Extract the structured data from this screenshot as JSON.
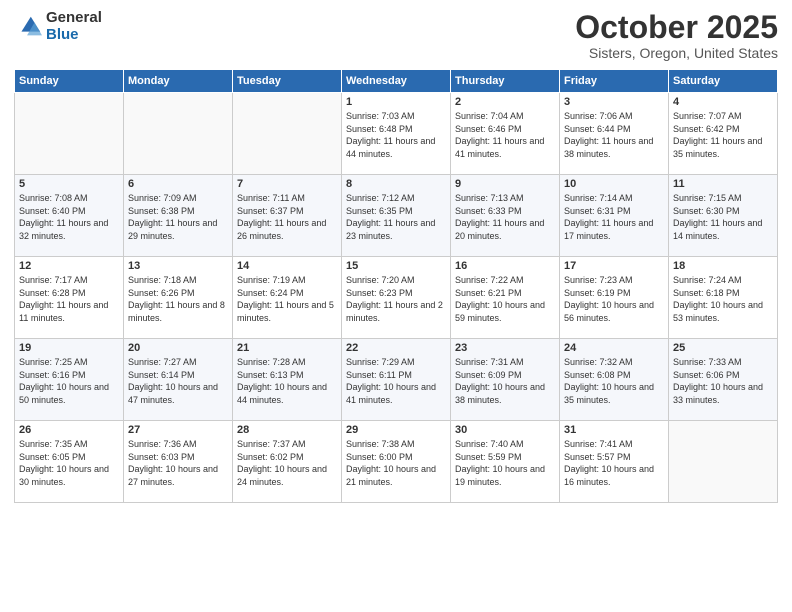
{
  "header": {
    "logo_general": "General",
    "logo_blue": "Blue",
    "month_title": "October 2025",
    "location": "Sisters, Oregon, United States"
  },
  "weekdays": [
    "Sunday",
    "Monday",
    "Tuesday",
    "Wednesday",
    "Thursday",
    "Friday",
    "Saturday"
  ],
  "weeks": [
    [
      {
        "day": "",
        "info": ""
      },
      {
        "day": "",
        "info": ""
      },
      {
        "day": "",
        "info": ""
      },
      {
        "day": "1",
        "info": "Sunrise: 7:03 AM\nSunset: 6:48 PM\nDaylight: 11 hours\nand 44 minutes."
      },
      {
        "day": "2",
        "info": "Sunrise: 7:04 AM\nSunset: 6:46 PM\nDaylight: 11 hours\nand 41 minutes."
      },
      {
        "day": "3",
        "info": "Sunrise: 7:06 AM\nSunset: 6:44 PM\nDaylight: 11 hours\nand 38 minutes."
      },
      {
        "day": "4",
        "info": "Sunrise: 7:07 AM\nSunset: 6:42 PM\nDaylight: 11 hours\nand 35 minutes."
      }
    ],
    [
      {
        "day": "5",
        "info": "Sunrise: 7:08 AM\nSunset: 6:40 PM\nDaylight: 11 hours\nand 32 minutes."
      },
      {
        "day": "6",
        "info": "Sunrise: 7:09 AM\nSunset: 6:38 PM\nDaylight: 11 hours\nand 29 minutes."
      },
      {
        "day": "7",
        "info": "Sunrise: 7:11 AM\nSunset: 6:37 PM\nDaylight: 11 hours\nand 26 minutes."
      },
      {
        "day": "8",
        "info": "Sunrise: 7:12 AM\nSunset: 6:35 PM\nDaylight: 11 hours\nand 23 minutes."
      },
      {
        "day": "9",
        "info": "Sunrise: 7:13 AM\nSunset: 6:33 PM\nDaylight: 11 hours\nand 20 minutes."
      },
      {
        "day": "10",
        "info": "Sunrise: 7:14 AM\nSunset: 6:31 PM\nDaylight: 11 hours\nand 17 minutes."
      },
      {
        "day": "11",
        "info": "Sunrise: 7:15 AM\nSunset: 6:30 PM\nDaylight: 11 hours\nand 14 minutes."
      }
    ],
    [
      {
        "day": "12",
        "info": "Sunrise: 7:17 AM\nSunset: 6:28 PM\nDaylight: 11 hours\nand 11 minutes."
      },
      {
        "day": "13",
        "info": "Sunrise: 7:18 AM\nSunset: 6:26 PM\nDaylight: 11 hours\nand 8 minutes."
      },
      {
        "day": "14",
        "info": "Sunrise: 7:19 AM\nSunset: 6:24 PM\nDaylight: 11 hours\nand 5 minutes."
      },
      {
        "day": "15",
        "info": "Sunrise: 7:20 AM\nSunset: 6:23 PM\nDaylight: 11 hours\nand 2 minutes."
      },
      {
        "day": "16",
        "info": "Sunrise: 7:22 AM\nSunset: 6:21 PM\nDaylight: 10 hours\nand 59 minutes."
      },
      {
        "day": "17",
        "info": "Sunrise: 7:23 AM\nSunset: 6:19 PM\nDaylight: 10 hours\nand 56 minutes."
      },
      {
        "day": "18",
        "info": "Sunrise: 7:24 AM\nSunset: 6:18 PM\nDaylight: 10 hours\nand 53 minutes."
      }
    ],
    [
      {
        "day": "19",
        "info": "Sunrise: 7:25 AM\nSunset: 6:16 PM\nDaylight: 10 hours\nand 50 minutes."
      },
      {
        "day": "20",
        "info": "Sunrise: 7:27 AM\nSunset: 6:14 PM\nDaylight: 10 hours\nand 47 minutes."
      },
      {
        "day": "21",
        "info": "Sunrise: 7:28 AM\nSunset: 6:13 PM\nDaylight: 10 hours\nand 44 minutes."
      },
      {
        "day": "22",
        "info": "Sunrise: 7:29 AM\nSunset: 6:11 PM\nDaylight: 10 hours\nand 41 minutes."
      },
      {
        "day": "23",
        "info": "Sunrise: 7:31 AM\nSunset: 6:09 PM\nDaylight: 10 hours\nand 38 minutes."
      },
      {
        "day": "24",
        "info": "Sunrise: 7:32 AM\nSunset: 6:08 PM\nDaylight: 10 hours\nand 35 minutes."
      },
      {
        "day": "25",
        "info": "Sunrise: 7:33 AM\nSunset: 6:06 PM\nDaylight: 10 hours\nand 33 minutes."
      }
    ],
    [
      {
        "day": "26",
        "info": "Sunrise: 7:35 AM\nSunset: 6:05 PM\nDaylight: 10 hours\nand 30 minutes."
      },
      {
        "day": "27",
        "info": "Sunrise: 7:36 AM\nSunset: 6:03 PM\nDaylight: 10 hours\nand 27 minutes."
      },
      {
        "day": "28",
        "info": "Sunrise: 7:37 AM\nSunset: 6:02 PM\nDaylight: 10 hours\nand 24 minutes."
      },
      {
        "day": "29",
        "info": "Sunrise: 7:38 AM\nSunset: 6:00 PM\nDaylight: 10 hours\nand 21 minutes."
      },
      {
        "day": "30",
        "info": "Sunrise: 7:40 AM\nSunset: 5:59 PM\nDaylight: 10 hours\nand 19 minutes."
      },
      {
        "day": "31",
        "info": "Sunrise: 7:41 AM\nSunset: 5:57 PM\nDaylight: 10 hours\nand 16 minutes."
      },
      {
        "day": "",
        "info": ""
      }
    ]
  ]
}
